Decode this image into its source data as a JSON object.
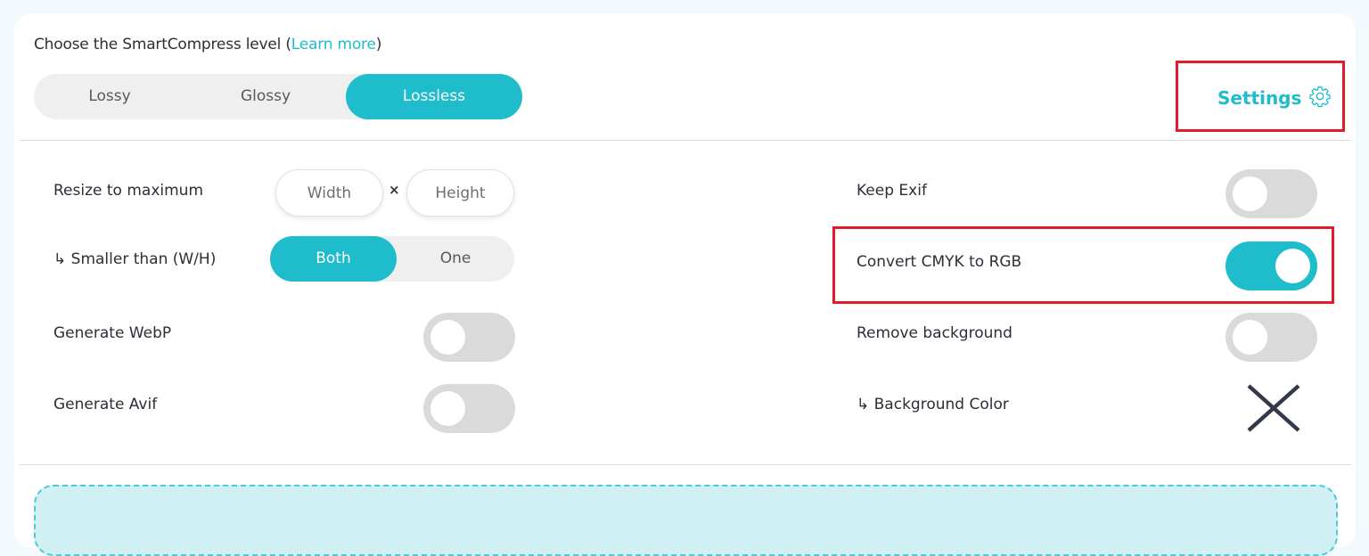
{
  "compress_level": {
    "label_prefix": "Choose the SmartCompress level (",
    "learn_more": "Learn more",
    "label_suffix": ")",
    "options": [
      "Lossy",
      "Glossy",
      "Lossless"
    ],
    "selected": "Lossless"
  },
  "settings": {
    "label": "Settings",
    "icon": "gear-icon"
  },
  "resize": {
    "label": "Resize to maximum",
    "width_placeholder": "Width",
    "height_placeholder": "Height",
    "times": "×"
  },
  "smaller_than": {
    "label": "↳ Smaller than (W/H)",
    "options": [
      "Both",
      "One"
    ],
    "selected": "Both"
  },
  "options_left": [
    {
      "label": "Generate WebP",
      "enabled": false
    },
    {
      "label": "Generate Avif",
      "enabled": false
    }
  ],
  "options_right": [
    {
      "label": "Keep Exif",
      "enabled": false
    },
    {
      "label": "Convert CMYK to RGB",
      "enabled": true
    },
    {
      "label": "Remove background",
      "enabled": false
    }
  ],
  "background_color": {
    "label": "↳ Background Color",
    "icon": "close-icon"
  },
  "colors": {
    "accent": "#1fbccb",
    "highlight_box": "#e01b2b",
    "toggle_off": "#dadada",
    "dropzone": "#d0f0f3"
  }
}
